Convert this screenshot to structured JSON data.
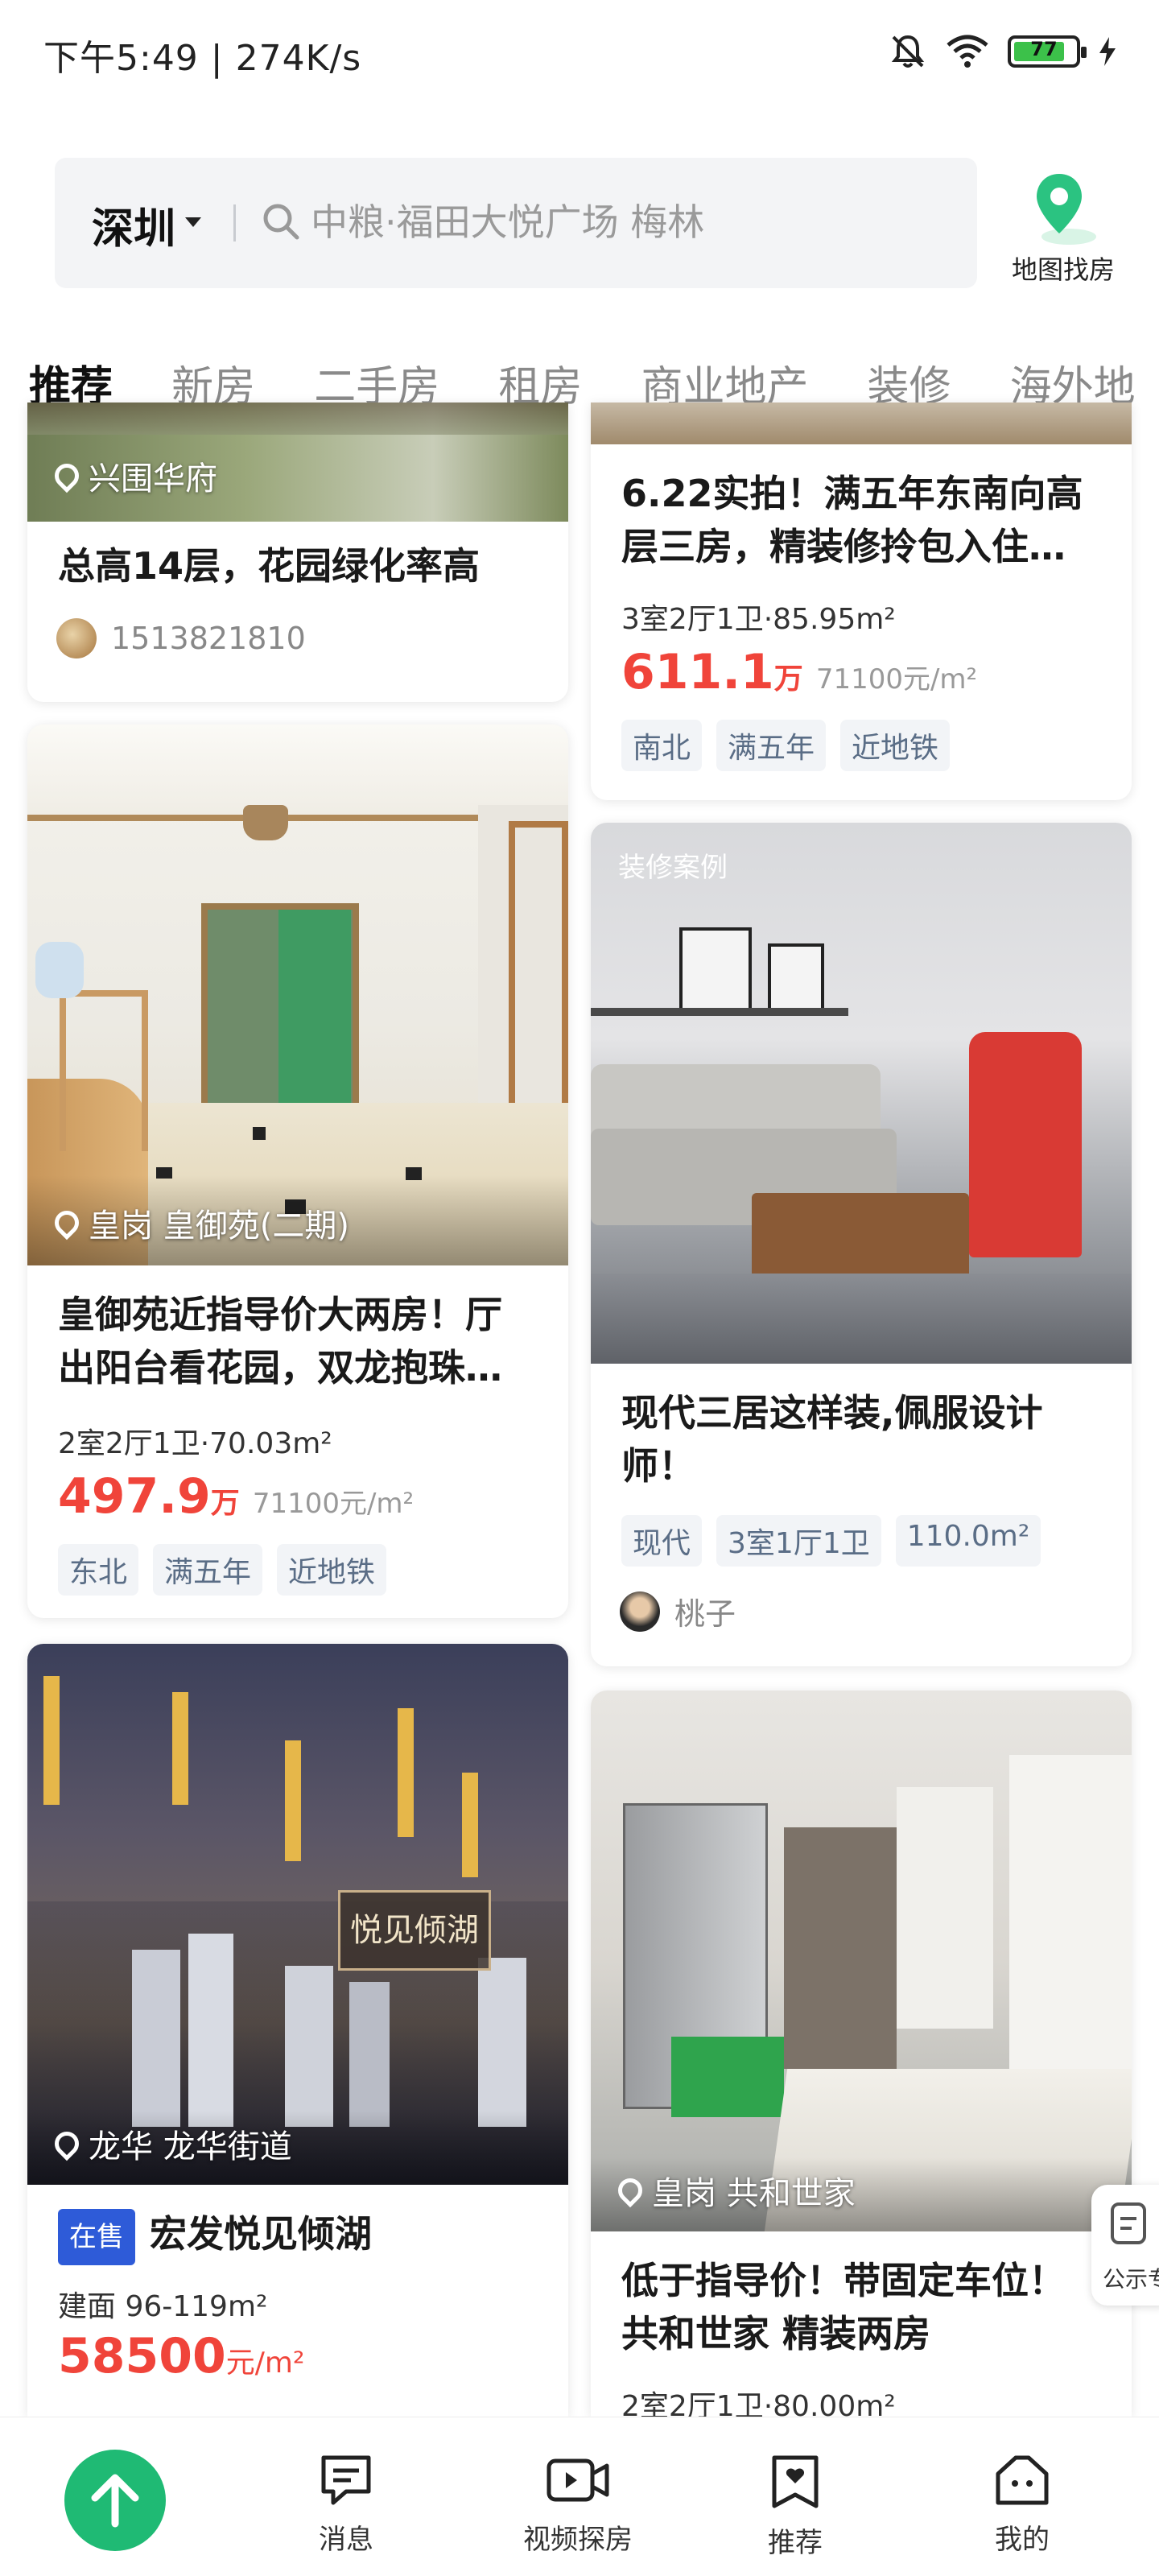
{
  "status_bar": {
    "time_speed": "下午5:49 | 274K/s",
    "battery": "77"
  },
  "header": {
    "city": "深圳",
    "search_placeholder": "中粮·福田大悦广场 梅林",
    "map_button_label": "地图找房"
  },
  "tabs": [
    {
      "label": "推荐",
      "active": true
    },
    {
      "label": "新房",
      "active": false
    },
    {
      "label": "二手房",
      "active": false
    },
    {
      "label": "租房",
      "active": false
    },
    {
      "label": "商业地产",
      "active": false
    },
    {
      "label": "装修",
      "active": false
    },
    {
      "label": "海外地",
      "active": false
    }
  ],
  "left_cards": [
    {
      "location": "兴围华府",
      "title": "总高14层，花园绿化率高",
      "author": "1513821810"
    },
    {
      "location": "皇岗 皇御苑(二期)",
      "title": "皇御苑近指导价大两房！厅出阳台看花园，双龙抱珠…",
      "spec": "2室2厅1卫·70.03m²",
      "price": "497.9",
      "price_unit": "万",
      "unit_price": "71100元/m²",
      "tags": [
        "东北",
        "满五年",
        "近地铁"
      ]
    },
    {
      "location": "龙华 龙华街道",
      "status": "在售",
      "title": "宏发悦见倾湖",
      "spec": "建面 96-119m²",
      "price": "58500",
      "price_unit": "元/m²",
      "image_sign": "悦见倾湖"
    }
  ],
  "right_cards": [
    {
      "title": "6.22实拍！满五年东南向高层三房，精装修拎包入住…",
      "spec": "3室2厅1卫·85.95m²",
      "price": "611.1",
      "price_unit": "万",
      "unit_price": "71100元/m²",
      "tags": [
        "南北",
        "满五年",
        "近地铁"
      ]
    },
    {
      "badge": "装修案例",
      "title": "现代三居这样装,佩服设计师！",
      "tags": [
        "现代",
        "3室1厅1卫",
        "110.0m²"
      ],
      "author": "桃子"
    },
    {
      "location": "皇岗 共和世家",
      "title": "低于指导价！带固定车位！共和世家 精装两房",
      "spec": "2室2厅1卫·80.00m²"
    }
  ],
  "float_notice": "公示专",
  "bottom_nav": [
    {
      "label": "消息",
      "icon": "message-icon"
    },
    {
      "label": "视频探房",
      "icon": "video-icon"
    },
    {
      "label": "推荐",
      "icon": "recommend-icon"
    },
    {
      "label": "我的",
      "icon": "profile-icon"
    }
  ],
  "colors": {
    "accent_green": "#1fba74",
    "price_red": "#f0443a",
    "tag_text": "#5a6d86",
    "sale_blue": "#2e5bd8"
  }
}
